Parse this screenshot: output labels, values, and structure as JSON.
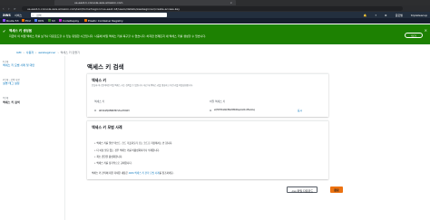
{
  "browser": {
    "tab_title": "us-east-1.console.aws.amazon.com",
    "url": "us-east-1.console.aws.amazon.com/iam/home?region=us-east-1#/users/details/awsbeginner/create-access-key"
  },
  "aws_nav": {
    "logo": "aws",
    "services": "서비스",
    "search_placeholder": "검색",
    "region": "글로벌",
    "account": "tripleteacup"
  },
  "favorites": [
    {
      "label": "Route 53",
      "color": "#8c4fff"
    },
    {
      "label": "EC2",
      "color": "#ed7100"
    },
    {
      "label": "RDS",
      "color": "#527fff"
    },
    {
      "label": "S3",
      "color": "#3f8624"
    },
    {
      "label": "CodeDeploy",
      "color": "#c925d1"
    },
    {
      "label": "Elastic Container Registry",
      "color": "#ed7100"
    }
  ],
  "banner": {
    "title": "액세스 키 생성됨",
    "body": "지금이 이 비밀 액세스 키를 보거나 다운로드할 수 있는 유일한 시간입니다. 나중에 비밀 액세스 키를 복구할 수 없습니다. 하지만 언제든지 새 액세스 키를 생성할 수 있습니다.",
    "button": "닫기",
    "accent": "#1d8102"
  },
  "breadcrumb": [
    "IAM",
    "사용자",
    "awsbeginner",
    "액세스 키 만들기"
  ],
  "sidebar": {
    "steps": [
      {
        "label": "1단계",
        "name": "액세스 키 모범 사례 및 대안"
      },
      {
        "label": "2단계 - 선택 사항",
        "name": "설명 태그 설정"
      },
      {
        "label": "3단계",
        "name": "액세스 키 검색"
      }
    ]
  },
  "main": {
    "title": "액세스 키 검색",
    "access_key_panel": {
      "title": "액세스 키",
      "desc": "분실하거나 잊어버린 비밀 액세스 키는 검색할 수 없습니다. 대신 새 액세스 키를 생성하고 이전 키를 비활성화합니다.",
      "col_access_key": "액세스 키",
      "col_secret_key": "비밀 액세스 키",
      "access_key_value": "AKIAVQU5NDHCSSLZXCW3",
      "secret_key_value": "eQT97DXoWmQfNaPdBhDOapVwOIx2MuAnGq",
      "show_link": "표시"
    },
    "best_practices_panel": {
      "title": "액세스 키 모범 사례",
      "items": [
        "액세스 키를 일반 텍스트, 코드 리포지토리 또는 코드로 저장해서는 안 됩니다.",
        "더 이상 필요 없는 경우 액세스 키를 비활성화하거나 삭제합니다.",
        "최소 권한을 활성화합니다.",
        "액세스 키를 정기적으로 교체합니다."
      ],
      "footer_prefix": "액세스 키 관리에 대한 자세한 내용은",
      "footer_link": "AWS 액세스 키 관리 모범 사례",
      "footer_suffix": "를 참조하세요."
    },
    "download_button": ".csv 파일 다운로드",
    "done_button": "완료"
  }
}
